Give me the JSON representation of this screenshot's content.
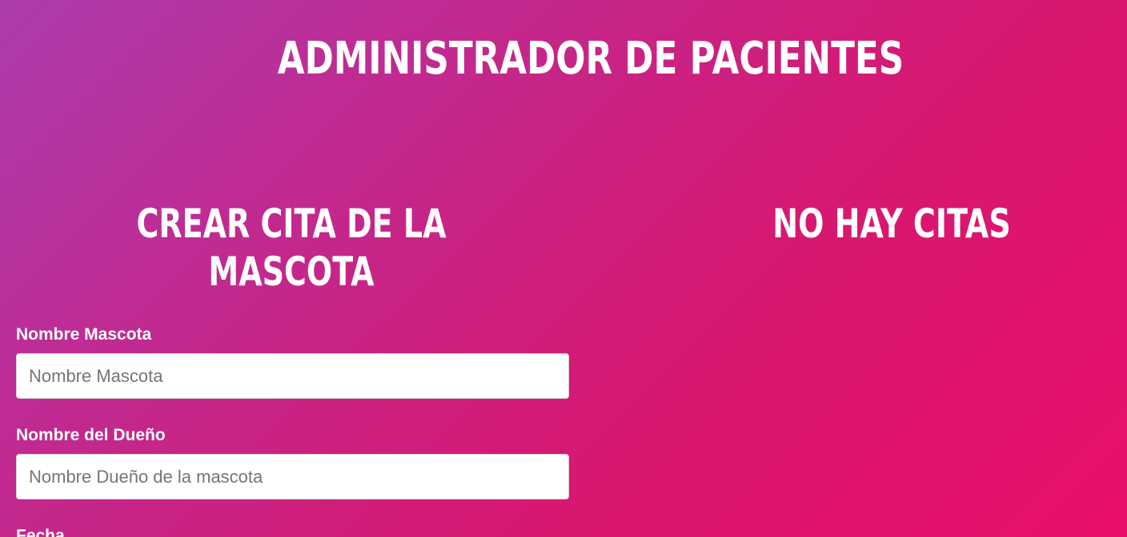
{
  "header": {
    "title": "ADMINISTRADOR DE PACIENTES"
  },
  "form_section": {
    "heading": "CREAR CITA DE LA MASCOTA",
    "fields": [
      {
        "label": "Nombre Mascota",
        "placeholder": "Nombre Mascota",
        "value": ""
      },
      {
        "label": "Nombre del Dueño",
        "placeholder": "Nombre Dueño de la mascota",
        "value": ""
      },
      {
        "label": "Fecha"
      }
    ]
  },
  "appointments_section": {
    "heading": "NO HAY CITAS"
  },
  "colors": {
    "gradient_start": "#ac3cad",
    "gradient_end": "#e9106a",
    "text": "#ffffff",
    "input_background": "#ffffff"
  }
}
